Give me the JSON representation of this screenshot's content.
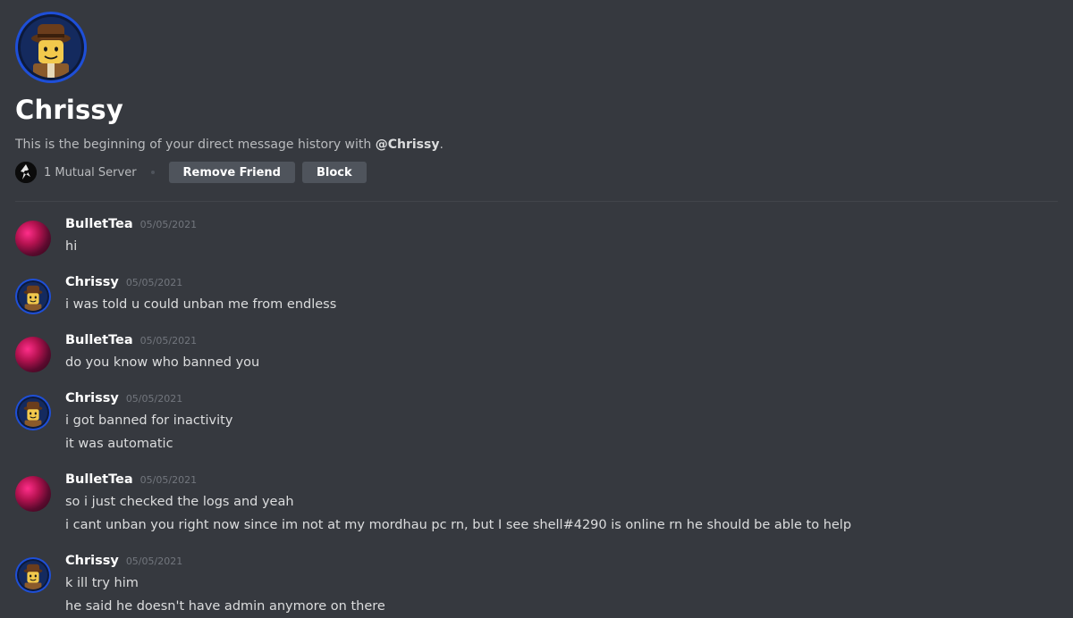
{
  "channel": {
    "title": "Chrissy",
    "intro_prefix": "This is the beginning of your direct message history with ",
    "intro_mention": "@Chrissy",
    "intro_suffix": ".",
    "mutual_servers": "1 Mutual Server",
    "remove_friend_label": "Remove Friend",
    "block_label": "Block"
  },
  "icons": {
    "profile_avatar": "lego-minifig-avatar-icon",
    "server_icon": "mutual-server-icon",
    "bullettea_avatar": "pink-abstract-avatar-icon"
  },
  "colors": {
    "background": "#36393f",
    "button": "#4f545c",
    "avatar_ring": "#1e4fd8"
  },
  "messages": [
    {
      "author": "BulletTea",
      "timestamp": "05/05/2021",
      "lines": [
        "hi"
      ]
    },
    {
      "author": "Chrissy",
      "timestamp": "05/05/2021",
      "lines": [
        "i was told u could unban me from endless"
      ]
    },
    {
      "author": "BulletTea",
      "timestamp": "05/05/2021",
      "lines": [
        "do you know who banned you"
      ]
    },
    {
      "author": "Chrissy",
      "timestamp": "05/05/2021",
      "lines": [
        "i got banned for inactivity",
        "it was automatic"
      ]
    },
    {
      "author": "BulletTea",
      "timestamp": "05/05/2021",
      "lines": [
        "so i just checked the logs and yeah",
        "i cant unban you right now since im not at my mordhau pc rn, but I see shell#4290 is online rn he should be able to help"
      ]
    },
    {
      "author": "Chrissy",
      "timestamp": "05/05/2021",
      "lines": [
        "k ill try him",
        "he said he doesn't have admin anymore on there"
      ]
    }
  ]
}
